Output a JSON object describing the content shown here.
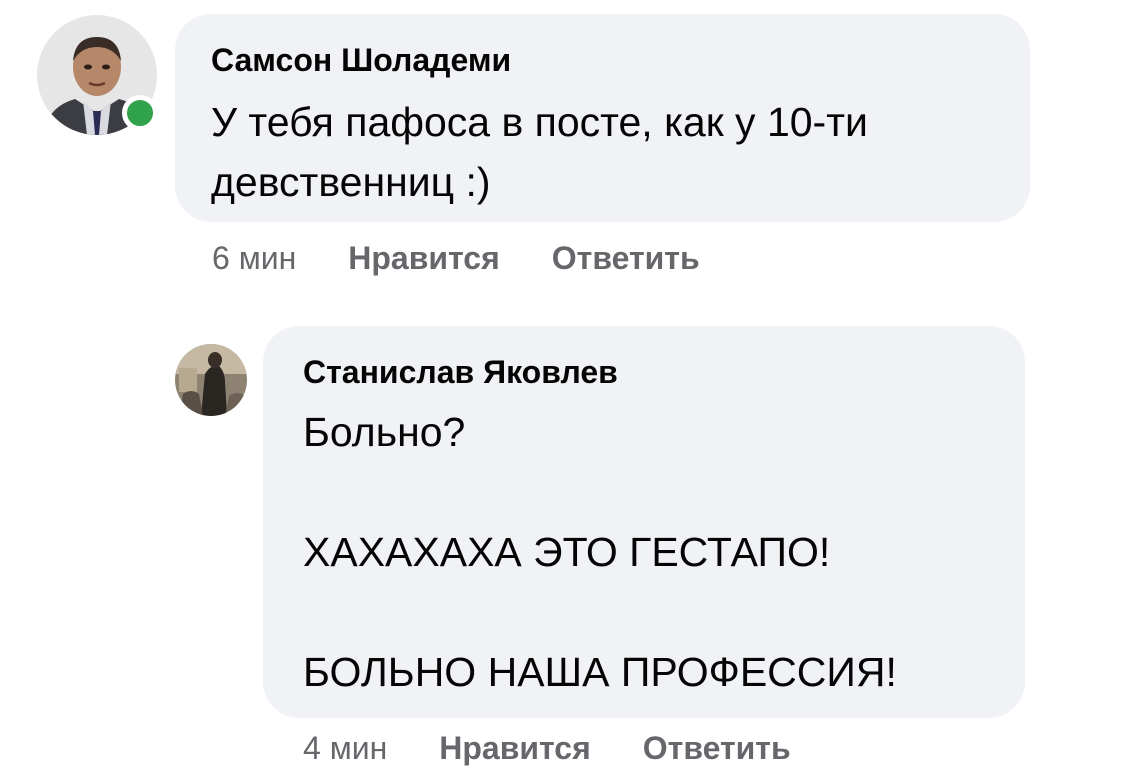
{
  "comments": [
    {
      "author": "Самсон Шоладеми",
      "lines": [
        "У тебя пафоса в посте, как у 10-ти",
        "девственниц :)"
      ],
      "time": "6 мин",
      "like_label": "Нравится",
      "reply_label": "Ответить",
      "online": true
    },
    {
      "author": "Станислав Яковлев",
      "lines": [
        "Больно?",
        "",
        "ХАХАХАХА ЭТО ГЕСТАПО!",
        "",
        "БОЛЬНО НАША ПРОФЕССИЯ!"
      ],
      "time": "4 мин",
      "like_label": "Нравится",
      "reply_label": "Ответить",
      "online": false
    }
  ],
  "colors": {
    "bubble": "#f0f2f5",
    "meta_text": "#65676b",
    "online": "#31a24c"
  }
}
